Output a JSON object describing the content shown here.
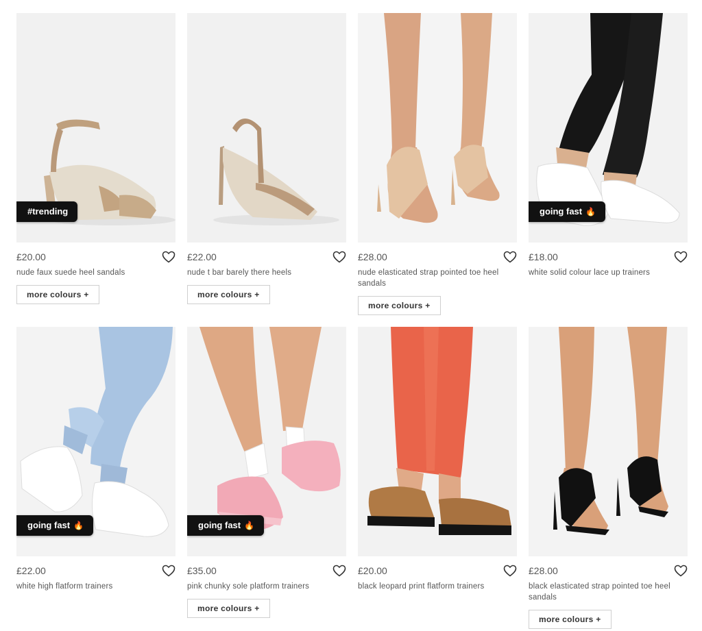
{
  "products": [
    {
      "price": "£20.00",
      "name": "nude faux suede heel sandals",
      "badge": "#trending",
      "more": "more colours +"
    },
    {
      "price": "£22.00",
      "name": "nude t bar barely there heels",
      "more": "more colours +"
    },
    {
      "price": "£28.00",
      "name": "nude elasticated strap pointed toe heel sandals",
      "more": "more colours +"
    },
    {
      "price": "£18.00",
      "name": "white solid colour lace up trainers",
      "badge": "going fast",
      "badge_icon": "🔥"
    },
    {
      "price": "£22.00",
      "name": "white high flatform trainers",
      "badge": "going fast",
      "badge_icon": "🔥"
    },
    {
      "price": "£35.00",
      "name": "pink chunky sole platform trainers",
      "badge": "going fast",
      "badge_icon": "🔥",
      "more": "more colours +"
    },
    {
      "price": "£20.00",
      "name": "black leopard print flatform trainers"
    },
    {
      "price": "£28.00",
      "name": "black elasticated strap pointed toe heel sandals",
      "more": "more colours +"
    }
  ],
  "icons": {
    "wishlist": "heart-outline-icon",
    "badge_flame": "flame-icon"
  }
}
